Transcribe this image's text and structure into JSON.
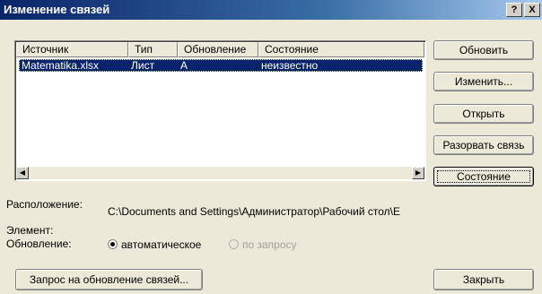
{
  "window": {
    "title": "Изменение связей",
    "help": "?",
    "close": "X"
  },
  "table": {
    "columns": [
      "Источник",
      "Тип",
      "Обновление",
      "Состояние"
    ],
    "rows": [
      {
        "source": "Matematika.xlsx",
        "type": "Лист",
        "update": "A",
        "status": "неизвестно",
        "selected": true
      }
    ]
  },
  "buttons": {
    "update_values": "Обновить",
    "change_source": "Изменить...",
    "open": "Открыть",
    "break_link": "Разорвать связь",
    "check_status": "Состояние",
    "startup_prompt": "Запрос на обновление связей...",
    "close": "Закрыть"
  },
  "details": {
    "location_label": "Расположение:",
    "location_value": "C:\\Documents and Settings\\Администратор\\Рабочий стол\\E",
    "element_label": "Элемент:",
    "update_label": "Обновление:",
    "auto_option": "автоматическое",
    "manual_option": "по запросу",
    "selected": "auto"
  }
}
